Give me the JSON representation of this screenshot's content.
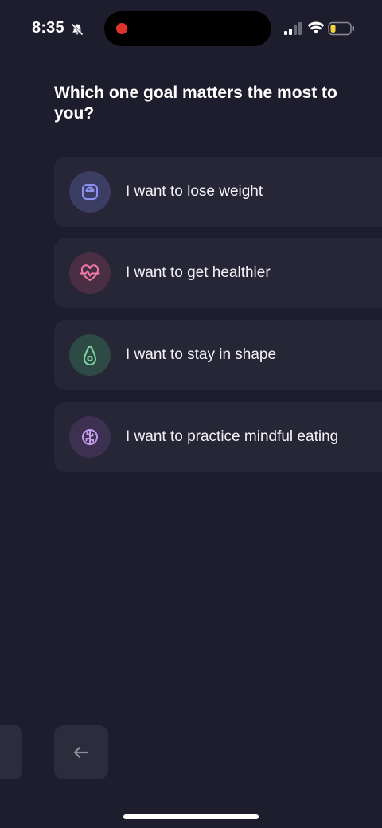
{
  "status_bar": {
    "time": "8:35",
    "icons": [
      "bell-slash-icon",
      "recording-dot-icon",
      "cellular-signal-icon",
      "wifi-icon",
      "battery-icon"
    ],
    "recording_color": "#e0332c",
    "battery_color": "#f5d33d",
    "battery_level": 0.2
  },
  "question": "Which one goal matters the most to you?",
  "options": [
    {
      "label": "I want to lose weight",
      "icon": "scale-icon",
      "icon_color": "#8a90f0",
      "icon_bg": "#3b3d63"
    },
    {
      "label": "I want to get healthier",
      "icon": "heart-pulse-icon",
      "icon_color": "#ef7aa6",
      "icon_bg": "#4a2f44"
    },
    {
      "label": "I want to stay in shape",
      "icon": "avocado-icon",
      "icon_color": "#7fd3a2",
      "icon_bg": "#2e4a45"
    },
    {
      "label": "I want to practice mindful eating",
      "icon": "brain-icon",
      "icon_color": "#c39be8",
      "icon_bg": "#3d3152"
    }
  ],
  "navigation": {
    "back_icon": "arrow-left-icon"
  },
  "colors": {
    "background": "#1e1d2e",
    "card": "#272637",
    "button": "#2d2c3c"
  }
}
